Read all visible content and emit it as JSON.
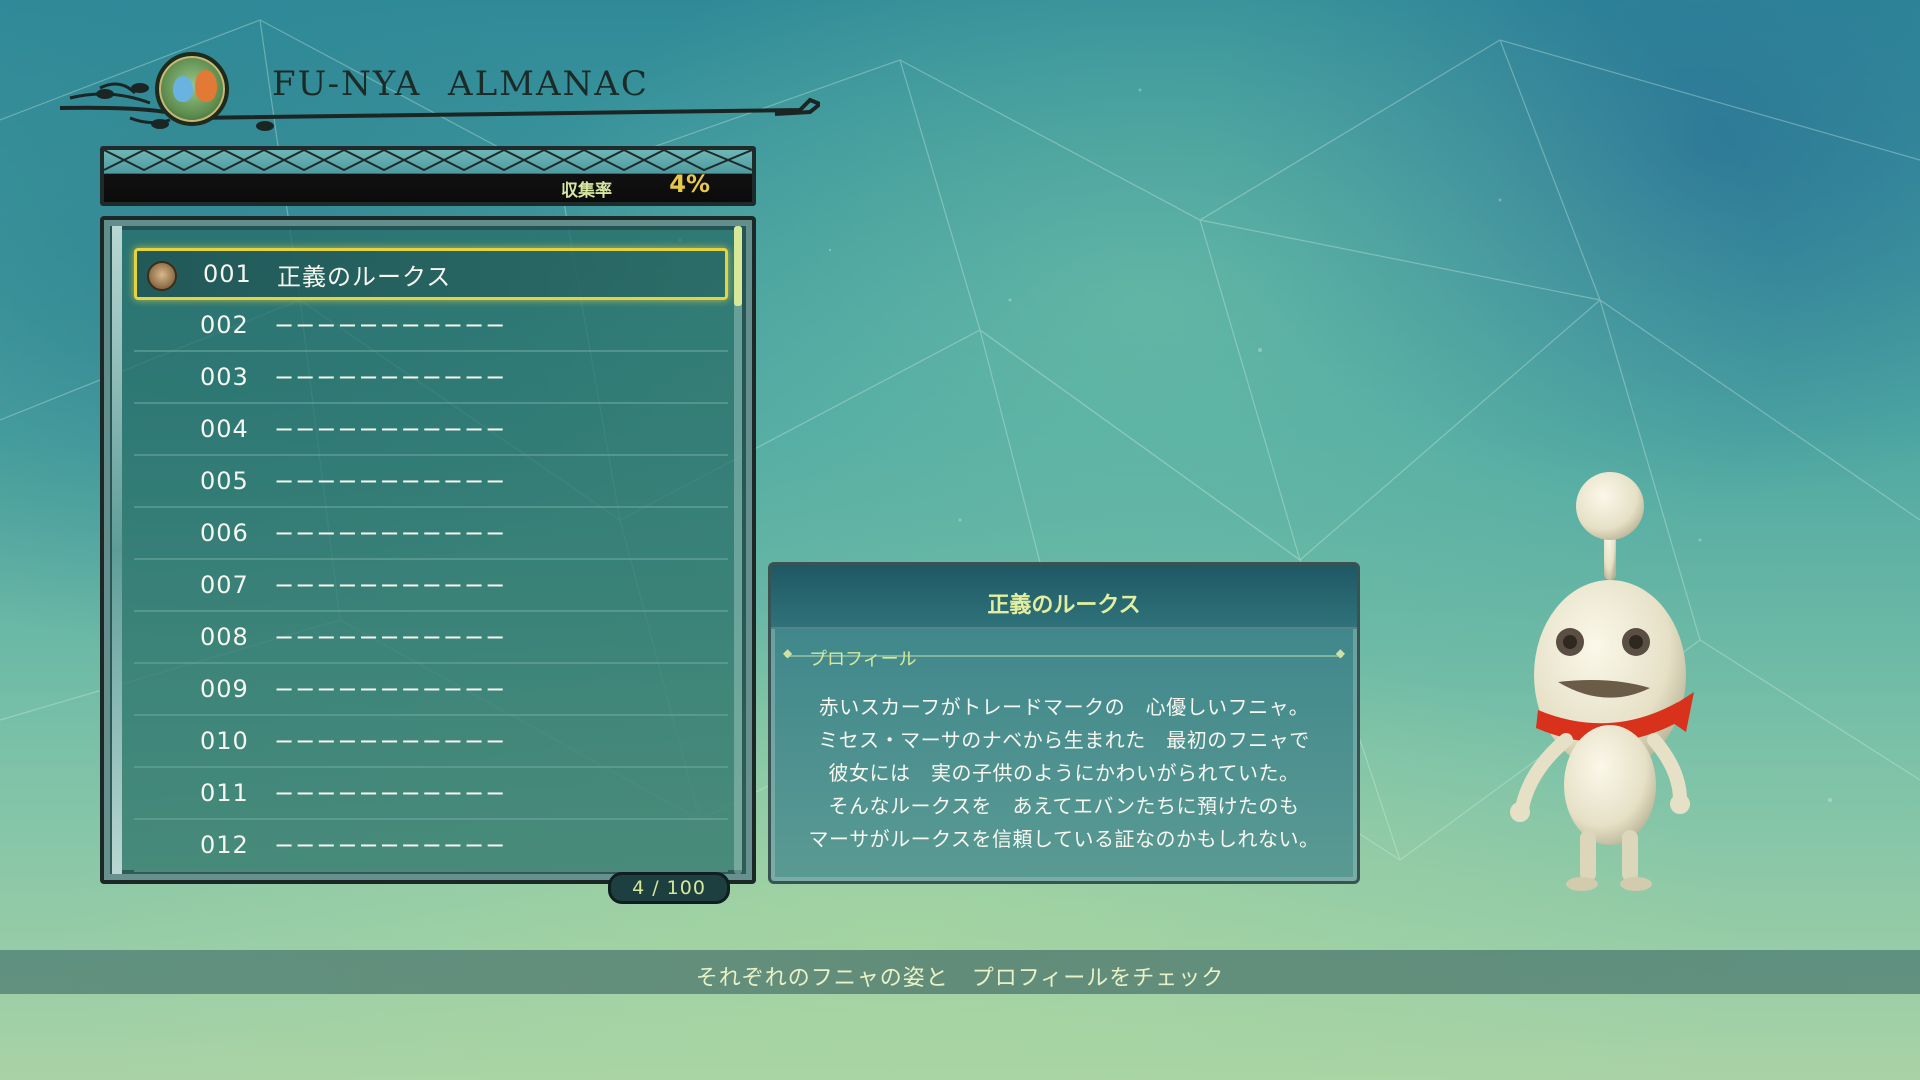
{
  "header": {
    "title": "FU-NYA  ALMANAC"
  },
  "collection": {
    "label": "収集率",
    "value": "4%"
  },
  "list": {
    "items": [
      {
        "number": "001",
        "name": "正義のルークス"
      },
      {
        "number": "002",
        "name": "−−−−−−−−−−−"
      },
      {
        "number": "003",
        "name": "−−−−−−−−−−−"
      },
      {
        "number": "004",
        "name": "−−−−−−−−−−−"
      },
      {
        "number": "005",
        "name": "−−−−−−−−−−−"
      },
      {
        "number": "006",
        "name": "−−−−−−−−−−−"
      },
      {
        "number": "007",
        "name": "−−−−−−−−−−−"
      },
      {
        "number": "008",
        "name": "−−−−−−−−−−−"
      },
      {
        "number": "009",
        "name": "−−−−−−−−−−−"
      },
      {
        "number": "010",
        "name": "−−−−−−−−−−−"
      },
      {
        "number": "011",
        "name": "−−−−−−−−−−−"
      },
      {
        "number": "012",
        "name": "−−−−−−−−−−−"
      }
    ],
    "page_count": "4  / 100"
  },
  "profile": {
    "name": "正義のルークス",
    "section": "プロフィール",
    "lines": [
      "赤いスカーフがトレードマークの　心優しいフニャ。",
      "ミセス・マーサのナベから生まれた　最初のフニャで",
      "彼女には　実の子供のようにかわいがられていた。",
      "そんなルークスを　あえてエバンたちに預けたのも",
      "マーサがルークスを信頼している証なのかもしれない。"
    ]
  },
  "hint": {
    "text": "それぞれのフニャの姿と　プロフィールをチェック"
  },
  "colors": {
    "highlight": "#e7d43c",
    "accent_text": "#d7e89a",
    "scarf": "#d9321c"
  }
}
